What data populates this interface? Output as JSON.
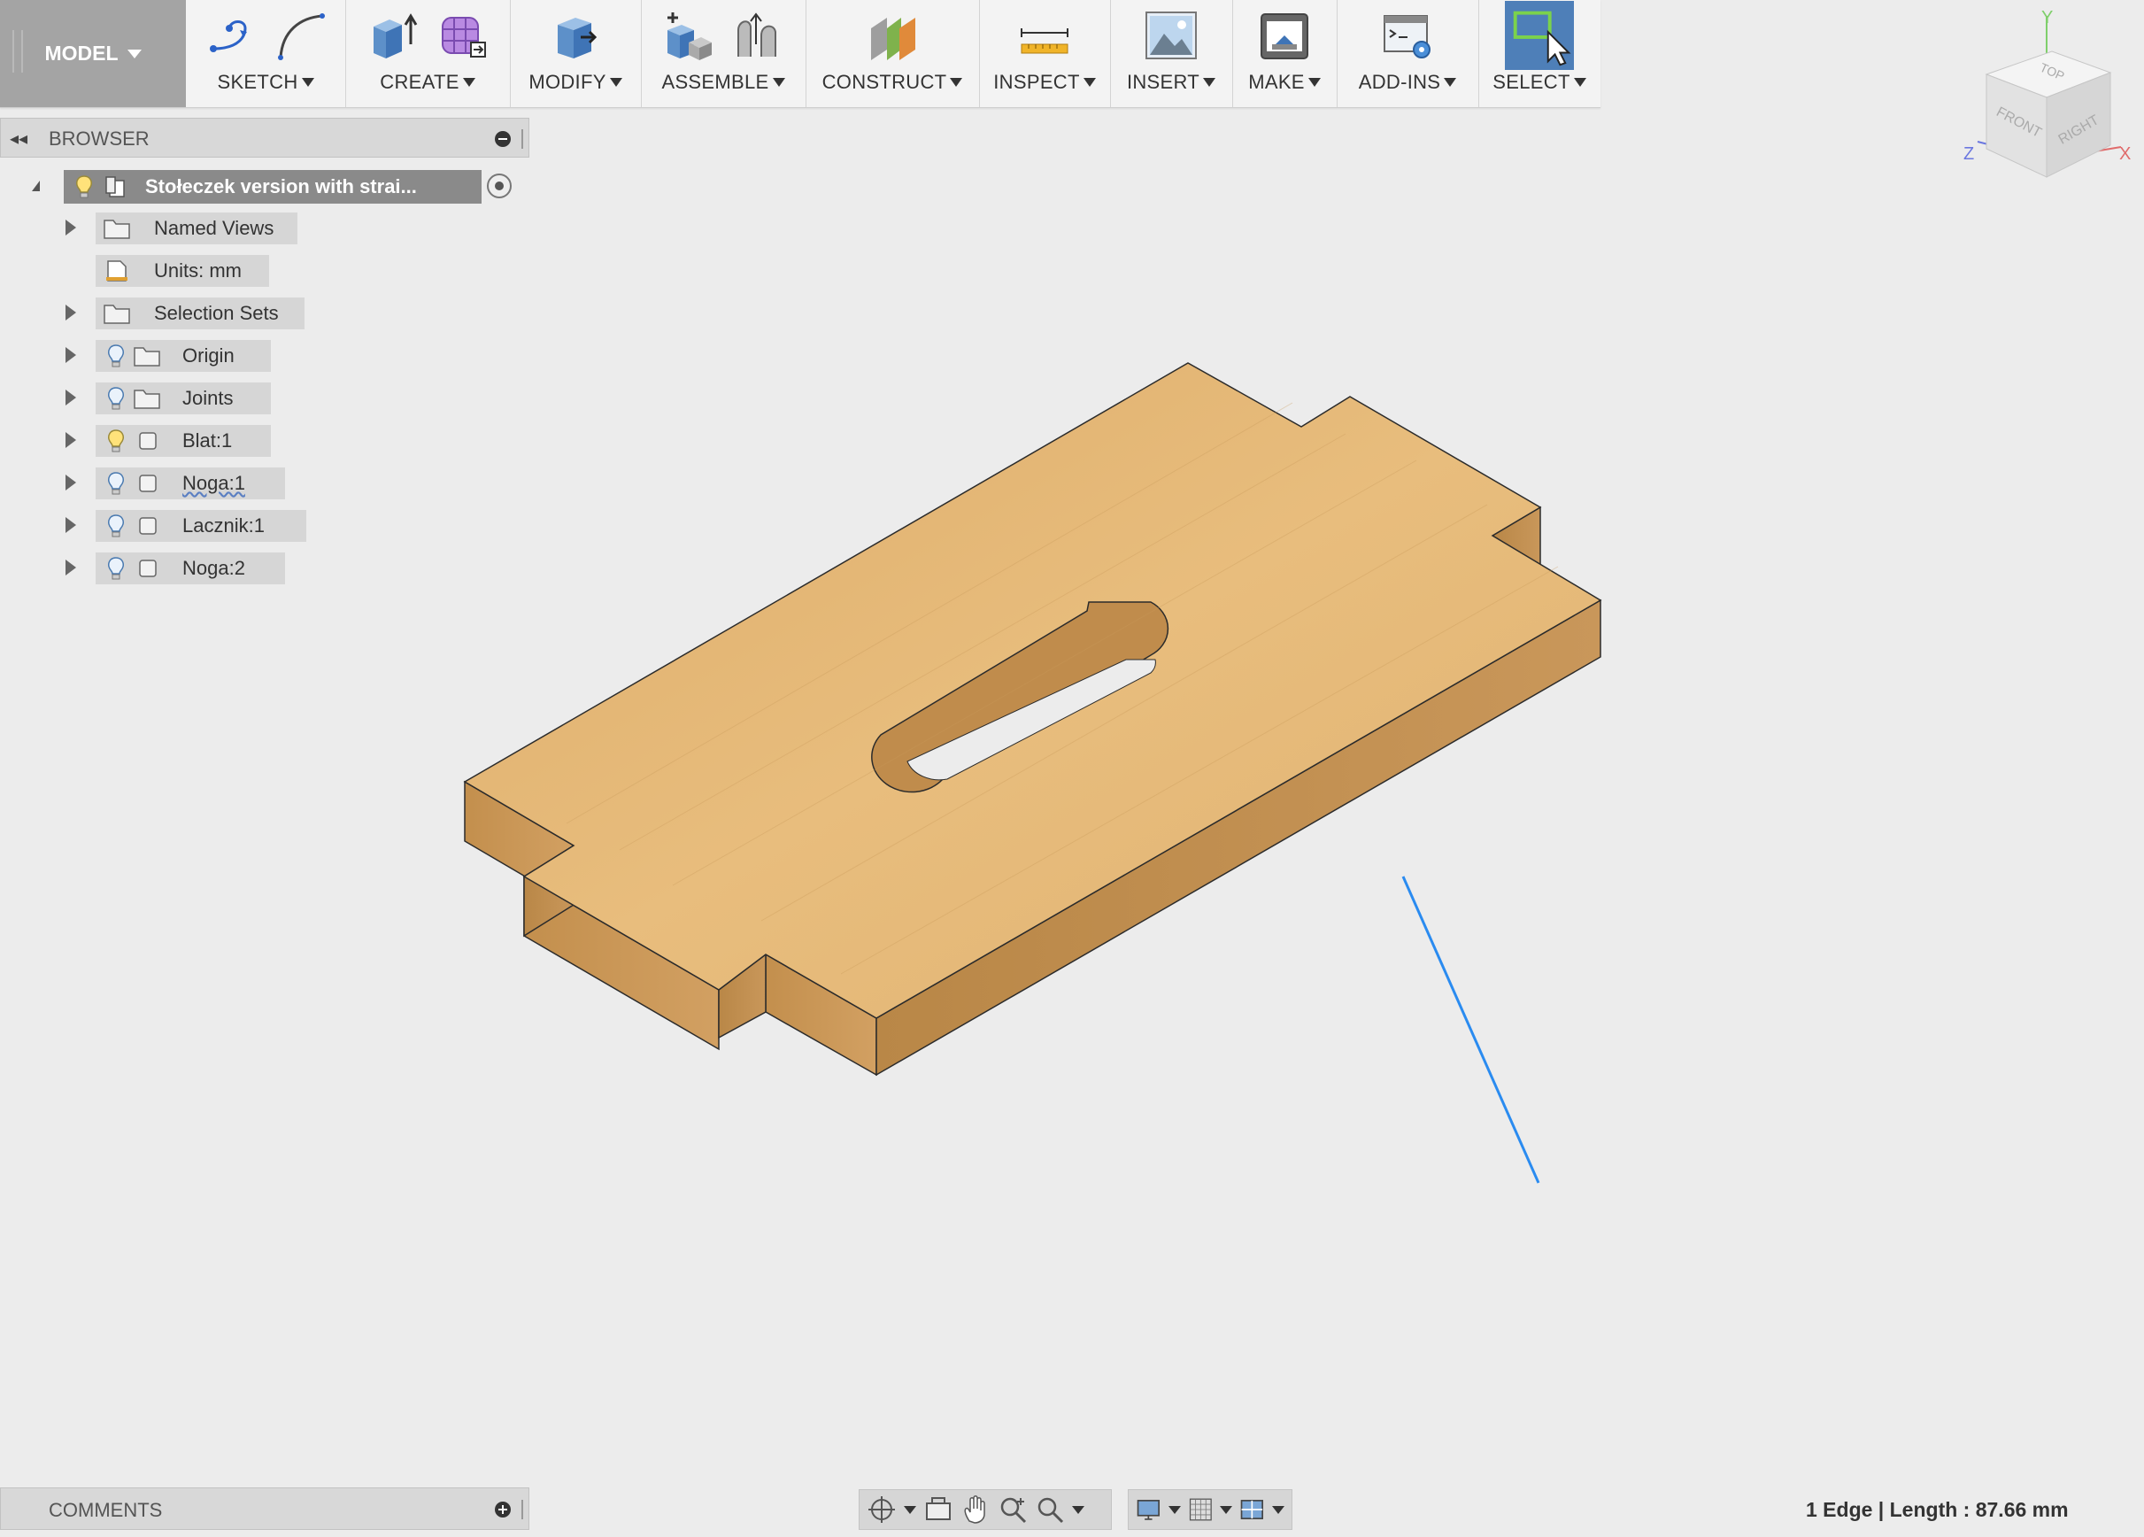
{
  "toolbar": {
    "workspace": "MODEL",
    "groups": [
      {
        "label": "SKETCH"
      },
      {
        "label": "CREATE"
      },
      {
        "label": "MODIFY"
      },
      {
        "label": "ASSEMBLE"
      },
      {
        "label": "CONSTRUCT"
      },
      {
        "label": "INSPECT"
      },
      {
        "label": "INSERT"
      },
      {
        "label": "MAKE"
      },
      {
        "label": "ADD-INS"
      },
      {
        "label": "SELECT"
      }
    ]
  },
  "browser": {
    "title": "BROWSER",
    "root": "Stołeczek version with strai...",
    "items": [
      {
        "label": "Named Views"
      },
      {
        "label": "Units: mm"
      },
      {
        "label": "Selection Sets"
      },
      {
        "label": "Origin"
      },
      {
        "label": "Joints"
      },
      {
        "label": "Blat:1"
      },
      {
        "label": "Noga:1"
      },
      {
        "label": "Lacznik:1"
      },
      {
        "label": "Noga:2"
      }
    ]
  },
  "comments": {
    "title": "COMMENTS"
  },
  "status": {
    "text": "1 Edge | Length : 87.66 mm"
  },
  "viewcube": {
    "faces": {
      "top": "TOP",
      "front": "FRONT",
      "right": "RIGHT"
    },
    "axes": {
      "x": "X",
      "y": "Y",
      "z": "Z"
    }
  },
  "colors": {
    "toolbar_bg": "#f3f3f3",
    "workspace_bg": "#a4a4a4",
    "canvas_bg": "#ececec",
    "wood_top": "#dfaf6c",
    "wood_side": "#c99550",
    "selected_edge": "#2a8bf0",
    "root_node_bg": "#8a8a8a"
  }
}
